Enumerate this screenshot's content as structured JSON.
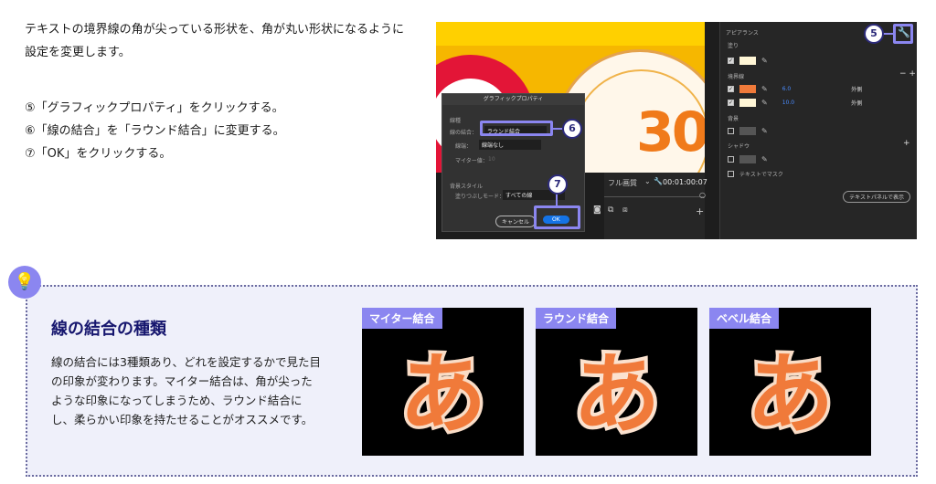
{
  "intro": "テキストの境界線の角が尖っている形状を、角が丸い形状になるように設定を変更します。",
  "steps": [
    "⑤「グラフィックプロパティ」をクリックする。",
    "⑥「線の結合」を「ラウンド結合」に変更する。",
    "⑦「OK」をクリックする。"
  ],
  "screenshot": {
    "canvas_number": "30",
    "timebar": {
      "quality": "フル画質",
      "timecode": "00:01:00:07",
      "plus": "+"
    },
    "panel": {
      "heading": "アピアランス",
      "fill": "塗り",
      "stroke": "境界線",
      "stroke_controls": "− +",
      "stroke_rows": [
        {
          "value": "6.0",
          "position": "外側",
          "color": "#f07a3a"
        },
        {
          "value": "10.0",
          "position": "外側",
          "color": "#fff6d6"
        }
      ],
      "background": "背景",
      "shadow": "シャドウ",
      "shadow_plus": "+",
      "mask": "テキストでマスク",
      "show_in_text_panel": "テキストパネルで表示"
    },
    "dialog": {
      "title": "グラフィックプロパティ",
      "section_stroke": "線種",
      "line_join_label": "線の結合：",
      "line_join_value": "ラウンド結合",
      "line_cap_label": "線端：",
      "line_cap_value": "線端なし",
      "miter_label": "マイター値：",
      "miter_value": "10",
      "section_background": "背景スタイル",
      "fill_mode_label": "塗りつぶしモード：",
      "fill_mode_value": "すべての線",
      "cancel": "キャンセル",
      "ok": "OK"
    },
    "badges": [
      "5",
      "6",
      "7"
    ]
  },
  "tip": {
    "title": "線の結合の種類",
    "body": "線の結合には3種類あり、どれを設定するかで見た目の印象が変わります。マイター結合は、角が尖ったような印象になってしまうため、ラウンド結合にし、柔らかい印象を持たせることがオススメです。",
    "examples": [
      {
        "label": "マイター結合",
        "glyph": "あ"
      },
      {
        "label": "ラウンド結合",
        "glyph": "あ"
      },
      {
        "label": "ベベル結合",
        "glyph": "あ"
      }
    ]
  }
}
